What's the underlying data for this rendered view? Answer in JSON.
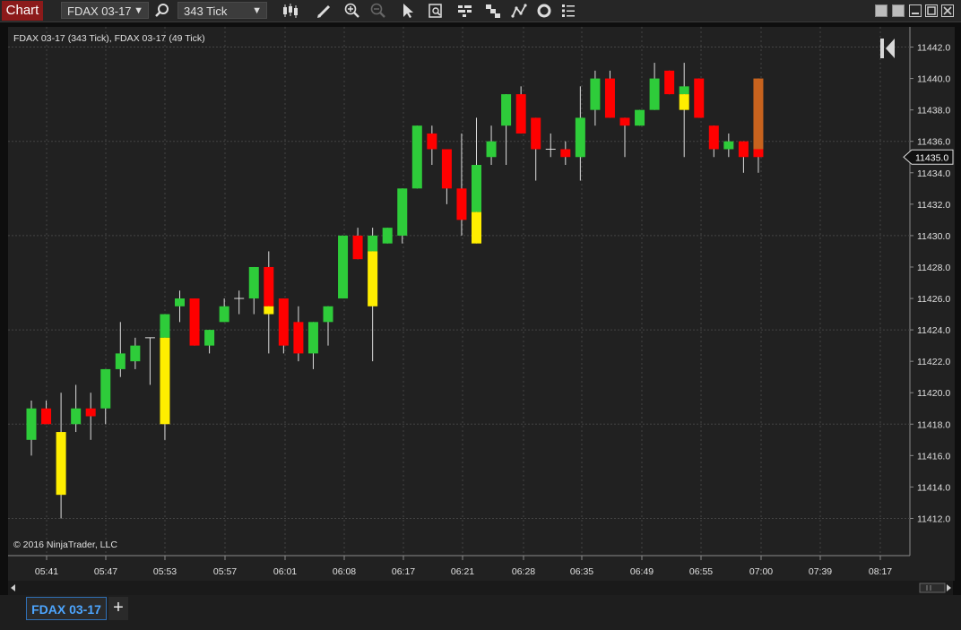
{
  "toolbar": {
    "chart_label": "Chart",
    "instrument": "FDAX 03-17",
    "interval": "343 Tick",
    "icons": [
      "search-icon",
      "bar-style-icon",
      "pencil-icon",
      "zoom-in-icon",
      "zoom-out-icon",
      "pointer-icon",
      "data-box-icon",
      "strategies-icon",
      "indicators-icon",
      "drawing-tools-icon",
      "refresh-icon",
      "properties-icon"
    ]
  },
  "window_controls": [
    "tile-left-icon",
    "tile-right-icon",
    "minimize-icon",
    "maximize-icon",
    "close-icon"
  ],
  "tabs": {
    "active": "FDAX 03-17",
    "add": "+"
  },
  "colors": {
    "up": "#2ecc3a",
    "down": "#ff0000",
    "highlight": "#ffee00",
    "last": "#c8631e",
    "background": "#212121",
    "grid": "#444444"
  },
  "chart_data": {
    "type": "candlestick",
    "title": "FDAX 03-17 (343 Tick), FDAX 03-17 (49 Tick)",
    "copyright": "© 2016 NinjaTrader, LLC",
    "ylim": [
      11411,
      11443
    ],
    "y_ticks": [
      11412,
      11414,
      11416,
      11418,
      11420,
      11422,
      11424,
      11426,
      11428,
      11430,
      11432,
      11434,
      11436,
      11438,
      11440,
      11442
    ],
    "y_tick_labels": [
      "11412.0",
      "11414.0",
      "11416.0",
      "11418.0",
      "11420.0",
      "11422.0",
      "11424.0",
      "11426.0",
      "11428.0",
      "11430.0",
      "11432.0",
      "11434.0",
      "11436.0",
      "11438.0",
      "11440.0",
      "11442.0"
    ],
    "x_tick_labels": [
      "05:41",
      "05:47",
      "05:53",
      "05:57",
      "06:01",
      "06:08",
      "06:17",
      "06:21",
      "06:28",
      "06:35",
      "06:49",
      "06:55",
      "07:00",
      "07:39",
      "08:17"
    ],
    "current_price": 11435,
    "current_price_label": "11435.0",
    "candles": [
      {
        "o": 11417,
        "h": 11419.5,
        "l": 11416,
        "c": 11419,
        "hl": null
      },
      {
        "o": 11419,
        "h": 11419.5,
        "l": 11418,
        "c": 11418,
        "hl": null
      },
      {
        "o": 11417.5,
        "h": 11420,
        "l": 11412,
        "c": 11413.5,
        "hl": "full"
      },
      {
        "o": 11418,
        "h": 11420.5,
        "l": 11417.5,
        "c": 11419,
        "hl": null
      },
      {
        "o": 11419,
        "h": 11420,
        "l": 11417,
        "c": 11418.5,
        "hl": null
      },
      {
        "o": 11419,
        "h": 11421.5,
        "l": 11418,
        "c": 11421.5,
        "hl": null
      },
      {
        "o": 11421.5,
        "h": 11424.5,
        "l": 11421,
        "c": 11422.5,
        "hl": null
      },
      {
        "o": 11422,
        "h": 11423.5,
        "l": 11421.5,
        "c": 11423,
        "hl": null
      },
      {
        "o": 11423.5,
        "h": 11423.5,
        "l": 11420.5,
        "c": 11423.5,
        "hl": null
      },
      {
        "o": 11418,
        "h": 11425,
        "l": 11417,
        "c": 11425,
        "hl": "bottom",
        "split": 11423.5
      },
      {
        "o": 11425.5,
        "h": 11426.5,
        "l": 11424.5,
        "c": 11426,
        "hl": null
      },
      {
        "o": 11426,
        "h": 11426,
        "l": 11423,
        "c": 11423,
        "hl": null
      },
      {
        "o": 11423,
        "h": 11424,
        "l": 11422.5,
        "c": 11424,
        "hl": null
      },
      {
        "o": 11424.5,
        "h": 11426,
        "l": 11424.5,
        "c": 11425.5,
        "hl": null
      },
      {
        "o": 11426,
        "h": 11426.5,
        "l": 11425,
        "c": 11426,
        "hl": null
      },
      {
        "o": 11426,
        "h": 11428,
        "l": 11425,
        "c": 11428,
        "hl": null
      },
      {
        "o": 11428,
        "h": 11429,
        "l": 11422.5,
        "c": 11425,
        "hl": "bottom",
        "split": 11425.5
      },
      {
        "o": 11426,
        "h": 11426,
        "l": 11422.5,
        "c": 11423,
        "hl": null
      },
      {
        "o": 11424.5,
        "h": 11425.5,
        "l": 11422,
        "c": 11422.5,
        "hl": null
      },
      {
        "o": 11422.5,
        "h": 11424.5,
        "l": 11421.5,
        "c": 11424.5,
        "hl": null
      },
      {
        "o": 11424.5,
        "h": 11425.5,
        "l": 11423,
        "c": 11425.5,
        "hl": null
      },
      {
        "o": 11426,
        "h": 11430,
        "l": 11426,
        "c": 11430,
        "hl": null
      },
      {
        "o": 11430,
        "h": 11430.5,
        "l": 11428.5,
        "c": 11428.5,
        "hl": null
      },
      {
        "o": 11425.5,
        "h": 11430.5,
        "l": 11422,
        "c": 11430,
        "hl": "bottom",
        "split": 11429
      },
      {
        "o": 11429.5,
        "h": 11430.5,
        "l": 11429.5,
        "c": 11430.5,
        "hl": null
      },
      {
        "o": 11430,
        "h": 11433,
        "l": 11429.5,
        "c": 11433,
        "hl": null
      },
      {
        "o": 11433,
        "h": 11437,
        "l": 11433,
        "c": 11437,
        "hl": null
      },
      {
        "o": 11436.5,
        "h": 11437,
        "l": 11434.5,
        "c": 11435.5,
        "hl": null
      },
      {
        "o": 11435.5,
        "h": 11435.5,
        "l": 11432,
        "c": 11433,
        "hl": null
      },
      {
        "o": 11433,
        "h": 11436.5,
        "l": 11430,
        "c": 11431,
        "hl": null
      },
      {
        "o": 11429.5,
        "h": 11437.5,
        "l": 11429.5,
        "c": 11434.5,
        "hl": "bottom",
        "split": 11431.5
      },
      {
        "o": 11435,
        "h": 11437,
        "l": 11434.5,
        "c": 11436,
        "hl": null
      },
      {
        "o": 11437,
        "h": 11439,
        "l": 11434.5,
        "c": 11439,
        "hl": null
      },
      {
        "o": 11439,
        "h": 11439.5,
        "l": 11436.5,
        "c": 11436.5,
        "hl": null
      },
      {
        "o": 11437.5,
        "h": 11437.5,
        "l": 11433.5,
        "c": 11435.5,
        "hl": null
      },
      {
        "o": 11435.5,
        "h": 11436.5,
        "l": 11435,
        "c": 11435.5,
        "hl": null
      },
      {
        "o": 11435.5,
        "h": 11436,
        "l": 11434.5,
        "c": 11435,
        "hl": null
      },
      {
        "o": 11435,
        "h": 11439.5,
        "l": 11433.5,
        "c": 11437.5,
        "hl": null
      },
      {
        "o": 11438,
        "h": 11440.5,
        "l": 11437,
        "c": 11440,
        "hl": null
      },
      {
        "o": 11440,
        "h": 11440.5,
        "l": 11437.5,
        "c": 11437.5,
        "hl": null
      },
      {
        "o": 11437.5,
        "h": 11437.5,
        "l": 11435,
        "c": 11437,
        "hl": null
      },
      {
        "o": 11437,
        "h": 11438,
        "l": 11437,
        "c": 11438,
        "hl": null
      },
      {
        "o": 11438,
        "h": 11441,
        "l": 11438,
        "c": 11440,
        "hl": null
      },
      {
        "o": 11440.5,
        "h": 11440.5,
        "l": 11439,
        "c": 11439,
        "hl": null
      },
      {
        "o": 11438,
        "h": 11441,
        "l": 11435,
        "c": 11439.5,
        "hl": "bottom",
        "split": 11439
      },
      {
        "o": 11440,
        "h": 11440,
        "l": 11437.5,
        "c": 11437.5,
        "hl": null
      },
      {
        "o": 11437,
        "h": 11437,
        "l": 11435,
        "c": 11435.5,
        "hl": null
      },
      {
        "o": 11435.5,
        "h": 11436.5,
        "l": 11435,
        "c": 11436,
        "hl": null
      },
      {
        "o": 11436,
        "h": 11436,
        "l": 11434,
        "c": 11435,
        "hl": null
      },
      {
        "o": 11440,
        "h": 11440,
        "l": 11434,
        "c": 11435,
        "hl": "last",
        "split": 11435.5
      }
    ]
  }
}
